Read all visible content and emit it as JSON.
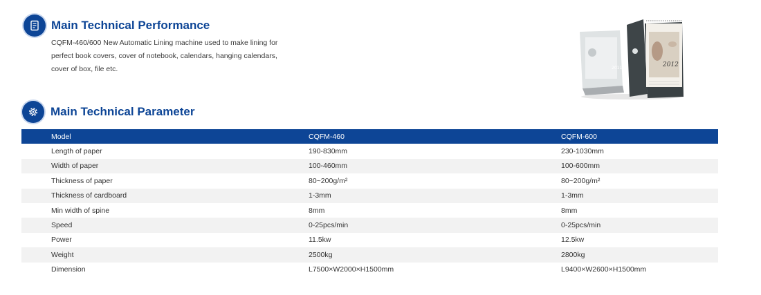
{
  "performance": {
    "title": "Main Technical Performance",
    "icon": "document-icon",
    "lines": [
      "CQFM-460/600 New Automatic Lining machine used to make lining for",
      "perfect book covers, cover of notebook, calendars, hanging calendars,",
      "cover of box, file etc."
    ]
  },
  "product_image": {
    "calendar_year_left": "2011",
    "calendar_year_right": "2012"
  },
  "parameter": {
    "title": "Main Technical Parameter",
    "icon": "gear-icon",
    "table": {
      "header": [
        "Model",
        "CQFM-460",
        "CQFM-600"
      ],
      "rows": [
        [
          "Length of paper",
          "190-830mm",
          "230-1030mm"
        ],
        [
          "Width of paper",
          "100-460mm",
          "100-600mm"
        ],
        [
          "Thickness of paper",
          "80~200g/m²",
          "80~200g/m²"
        ],
        [
          "Thickness of cardboard",
          "1-3mm",
          "1-3mm"
        ],
        [
          "Min width of spine",
          "8mm",
          "8mm"
        ],
        [
          "Speed",
          "0-25pcs/min",
          "0-25pcs/min"
        ],
        [
          "Power",
          "11.5kw",
          "12.5kw"
        ],
        [
          "Weight",
          "2500kg",
          "2800kg"
        ],
        [
          "Dimension",
          "L7500×W2000×H1500mm",
          "L9400×W2600×H1500mm"
        ]
      ]
    }
  },
  "colors": {
    "brand_blue": "#0d4596",
    "row_stripe": "#f2f2f2"
  }
}
